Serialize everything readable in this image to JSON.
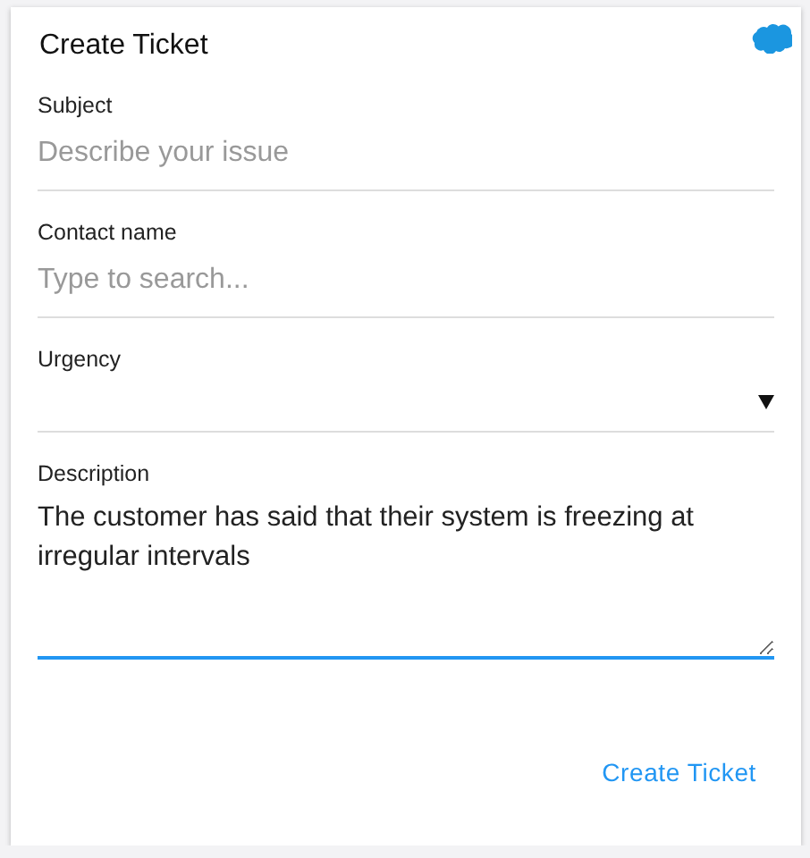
{
  "card": {
    "title": "Create Ticket"
  },
  "fields": [
    {
      "kind": "text",
      "label": "Subject",
      "placeholder": "Describe your issue",
      "focused": false
    },
    {
      "kind": "text",
      "label": "Contact name",
      "placeholder": "Type to search...",
      "focused": false
    },
    {
      "kind": "select",
      "label": "Urgency",
      "focused": false
    },
    {
      "kind": "textarea",
      "label": "Description",
      "value": "The customer has said that their system is freezing at irregular intervals",
      "focused": true
    }
  ],
  "actions": [
    {
      "label": "Create Ticket"
    }
  ]
}
